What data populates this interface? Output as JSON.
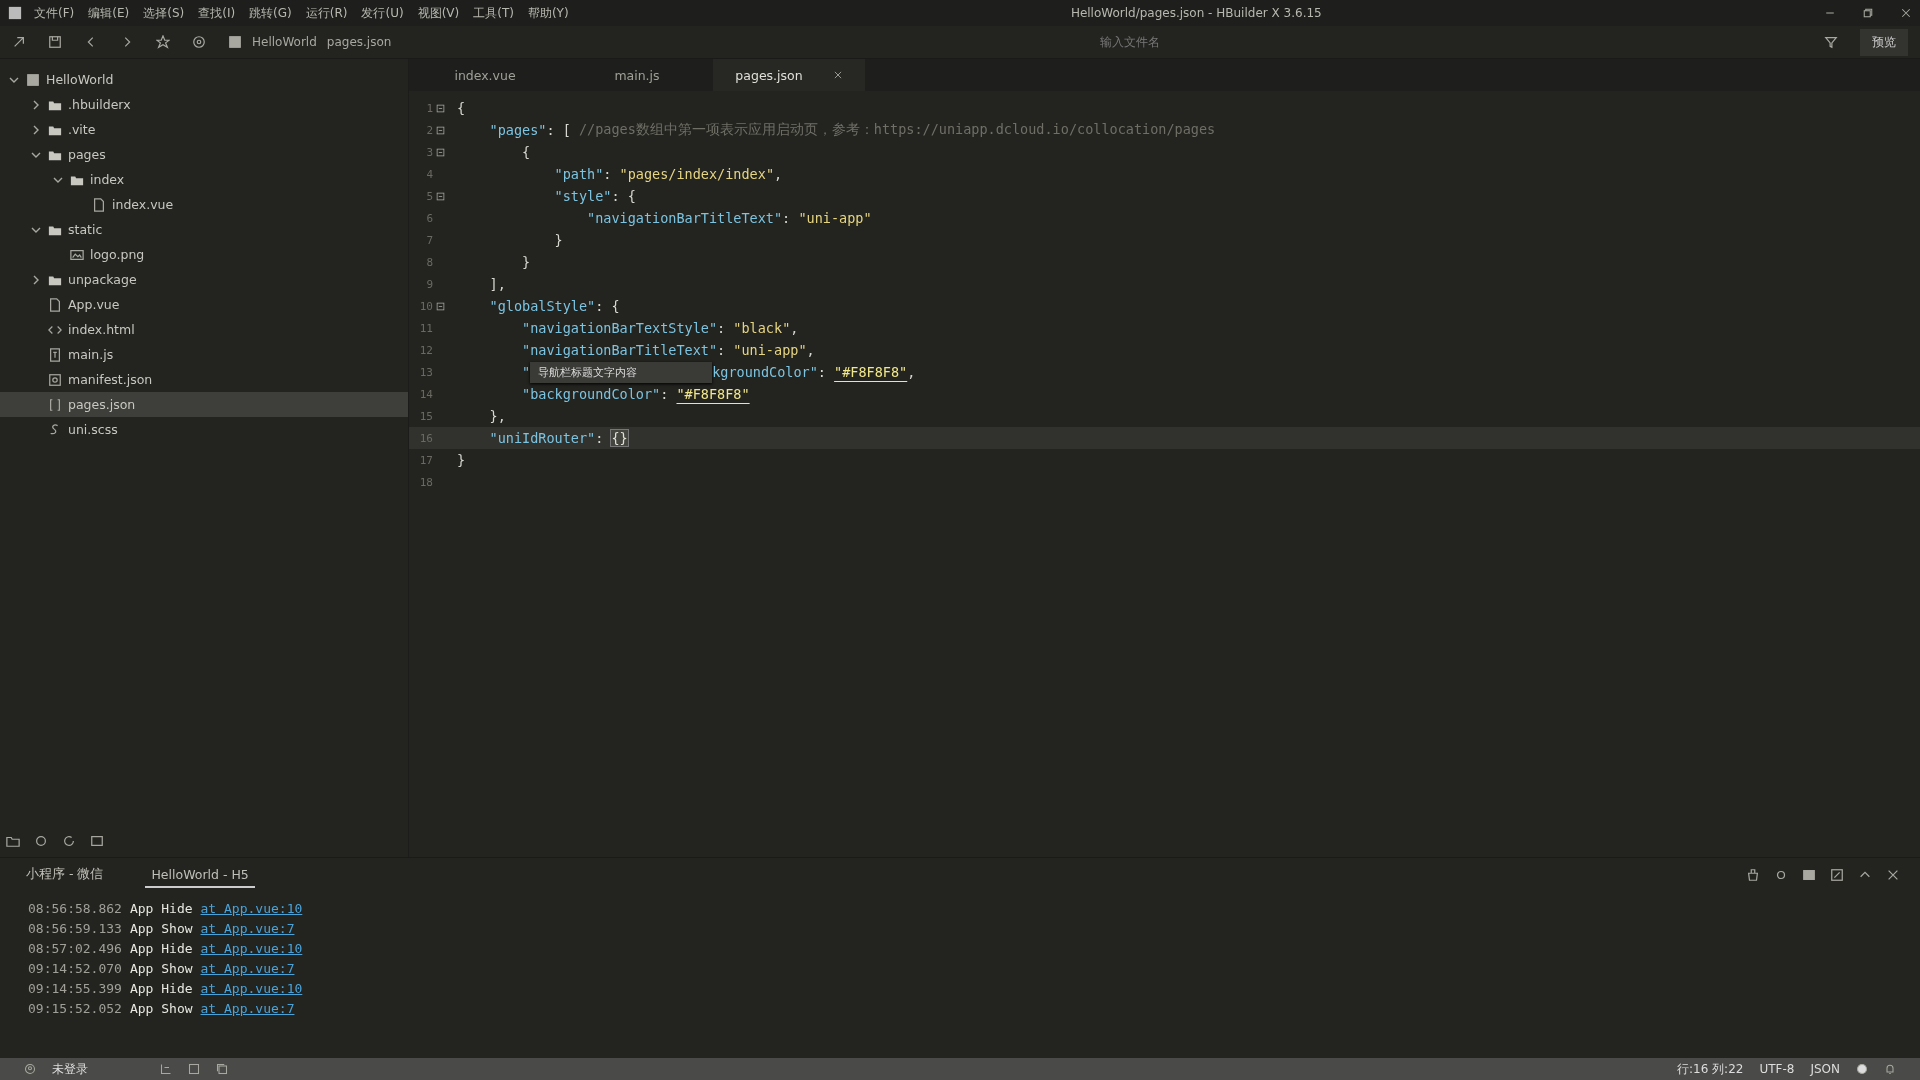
{
  "window": {
    "title": "HelloWorld/pages.json - HBuilder X 3.6.15"
  },
  "menu": [
    "文件(F)",
    "编辑(E)",
    "选择(S)",
    "查找(I)",
    "跳转(G)",
    "运行(R)",
    "发行(U)",
    "视图(V)",
    "工具(T)",
    "帮助(Y)"
  ],
  "toolbar": {
    "breadcrumb": [
      "HelloWorld",
      "pages.json"
    ],
    "search": {
      "placeholder": "输入文件名"
    },
    "preview_button": "预览"
  },
  "sidebar": {
    "tree": [
      {
        "label": "HelloWorld",
        "kind": "project",
        "expanded": true,
        "selected": false,
        "children": [
          {
            "label": ".hbuilderx",
            "kind": "folder",
            "expanded": false,
            "selected": false
          },
          {
            "label": ".vite",
            "kind": "folder",
            "expanded": false,
            "selected": false
          },
          {
            "label": "pages",
            "kind": "folder",
            "expanded": true,
            "selected": false,
            "children": [
              {
                "label": "index",
                "kind": "folder",
                "expanded": true,
                "selected": false,
                "children": [
                  {
                    "label": "index.vue",
                    "kind": "vue",
                    "selected": false
                  }
                ]
              }
            ]
          },
          {
            "label": "static",
            "kind": "folder",
            "expanded": true,
            "selected": false,
            "children": [
              {
                "label": "logo.png",
                "kind": "image",
                "selected": false
              }
            ]
          },
          {
            "label": "unpackage",
            "kind": "folder",
            "expanded": false,
            "selected": false
          },
          {
            "label": "App.vue",
            "kind": "vue",
            "selected": false
          },
          {
            "label": "index.html",
            "kind": "html",
            "selected": false
          },
          {
            "label": "main.js",
            "kind": "js",
            "selected": false
          },
          {
            "label": "manifest.json",
            "kind": "manifest",
            "selected": false
          },
          {
            "label": "pages.json",
            "kind": "json",
            "selected": true
          },
          {
            "label": "uni.scss",
            "kind": "scss",
            "selected": false
          }
        ]
      }
    ]
  },
  "editor": {
    "tabs": [
      {
        "label": "index.vue",
        "selected": false
      },
      {
        "label": "main.js",
        "selected": false
      },
      {
        "label": "pages.json",
        "selected": true
      }
    ],
    "lines": [
      {
        "number": "1",
        "fold": true,
        "current": false,
        "tokens": [
          {
            "kind": "punct",
            "text": "{"
          }
        ]
      },
      {
        "number": "2",
        "fold": true,
        "current": false,
        "tokens": [
          {
            "kind": "key",
            "text": "    \"pages\""
          },
          {
            "kind": "punct",
            "text": ": [ "
          },
          {
            "kind": "comment",
            "text": "//pages数组中第一项表示应用启动页，参考：https://uniapp.dcloud.io/collocation/pages"
          }
        ]
      },
      {
        "number": "3",
        "fold": true,
        "current": false,
        "tokens": [
          {
            "kind": "punct",
            "text": "        {"
          }
        ]
      },
      {
        "number": "4",
        "fold": false,
        "current": false,
        "tokens": [
          {
            "kind": "key",
            "text": "            \"path\""
          },
          {
            "kind": "punct",
            "text": ": "
          },
          {
            "kind": "string",
            "text": "\"pages/index/index\""
          },
          {
            "kind": "punct",
            "text": ","
          }
        ]
      },
      {
        "number": "5",
        "fold": true,
        "current": false,
        "tokens": [
          {
            "kind": "key",
            "text": "            \"style\""
          },
          {
            "kind": "punct",
            "text": ": {"
          }
        ]
      },
      {
        "number": "6",
        "fold": false,
        "current": false,
        "tokens": [
          {
            "kind": "key",
            "text": "                \"navigationBarTitleText\""
          },
          {
            "kind": "punct",
            "text": ": "
          },
          {
            "kind": "string",
            "text": "\"uni-app\""
          }
        ]
      },
      {
        "number": "7",
        "fold": false,
        "current": false,
        "tokens": [
          {
            "kind": "punct",
            "text": "            }"
          }
        ]
      },
      {
        "number": "8",
        "fold": false,
        "current": false,
        "tokens": [
          {
            "kind": "punct",
            "text": "        }"
          }
        ]
      },
      {
        "number": "9",
        "fold": false,
        "current": false,
        "tokens": [
          {
            "kind": "punct",
            "text": "    ],"
          }
        ]
      },
      {
        "number": "10",
        "fold": true,
        "current": false,
        "tokens": [
          {
            "kind": "key",
            "text": "    \"globalStyle\""
          },
          {
            "kind": "punct",
            "text": ": {"
          }
        ]
      },
      {
        "number": "11",
        "fold": false,
        "current": false,
        "tokens": [
          {
            "kind": "key",
            "text": "        \"navigationBarTextStyle\""
          },
          {
            "kind": "punct",
            "text": ": "
          },
          {
            "kind": "string",
            "text": "\"black\""
          },
          {
            "kind": "punct",
            "text": ","
          }
        ]
      },
      {
        "number": "12",
        "fold": false,
        "current": false,
        "tokens": [
          {
            "kind": "key",
            "text": "        \"navigationBarTitleText\""
          },
          {
            "kind": "punct",
            "text": ": "
          },
          {
            "kind": "string",
            "text": "\"uni-app\""
          },
          {
            "kind": "punct",
            "text": ","
          }
        ]
      },
      {
        "number": "13",
        "fold": false,
        "current": false,
        "tokens": [
          {
            "kind": "key",
            "text": "        \""
          },
          {
            "kind": "tooltip",
            "text": "导航栏标题文字内容"
          },
          {
            "kind": "key",
            "text": "kgroundColor\""
          },
          {
            "kind": "punct",
            "text": ": "
          },
          {
            "kind": "color",
            "text": "\"#F8F8F8\""
          },
          {
            "kind": "punct",
            "text": ","
          }
        ]
      },
      {
        "number": "14",
        "fold": false,
        "current": false,
        "tokens": [
          {
            "kind": "key",
            "text": "        \"backgroundColor\""
          },
          {
            "kind": "punct",
            "text": ": "
          },
          {
            "kind": "color",
            "text": "\"#F8F8F8\""
          }
        ]
      },
      {
        "number": "15",
        "fold": false,
        "current": false,
        "tokens": [
          {
            "kind": "punct",
            "text": "    },"
          }
        ]
      },
      {
        "number": "16",
        "fold": false,
        "current": true,
        "tokens": [
          {
            "kind": "key",
            "text": "    \"uniIdRouter\""
          },
          {
            "kind": "punct",
            "text": ": "
          },
          {
            "kind": "match",
            "text": "{}"
          }
        ]
      },
      {
        "number": "17",
        "fold": false,
        "current": false,
        "tokens": [
          {
            "kind": "punct",
            "text": "}"
          }
        ]
      },
      {
        "number": "18",
        "fold": false,
        "current": false
      }
    ]
  },
  "console": {
    "tabs": [
      {
        "label": "小程序 - 微信",
        "selected": false
      },
      {
        "label": "HelloWorld - H5",
        "selected": true
      }
    ],
    "lines": [
      {
        "time": "08:56:58.862",
        "message": "App Hide",
        "link": "at App.vue:10"
      },
      {
        "time": "08:56:59.133",
        "message": "App Show",
        "link": "at App.vue:7"
      },
      {
        "time": "08:57:02.496",
        "message": "App Hide",
        "link": "at App.vue:10"
      },
      {
        "time": "09:14:52.070",
        "message": "App Show",
        "link": "at App.vue:7"
      },
      {
        "time": "09:14:55.399",
        "message": "App Hide",
        "link": "at App.vue:10"
      },
      {
        "time": "09:15:52.052",
        "message": "App Show",
        "link": "at App.vue:7"
      }
    ]
  },
  "status_bar": {
    "login": "未登录",
    "position": "行:16  列:22",
    "encoding": "UTF-8",
    "language": "JSON"
  }
}
